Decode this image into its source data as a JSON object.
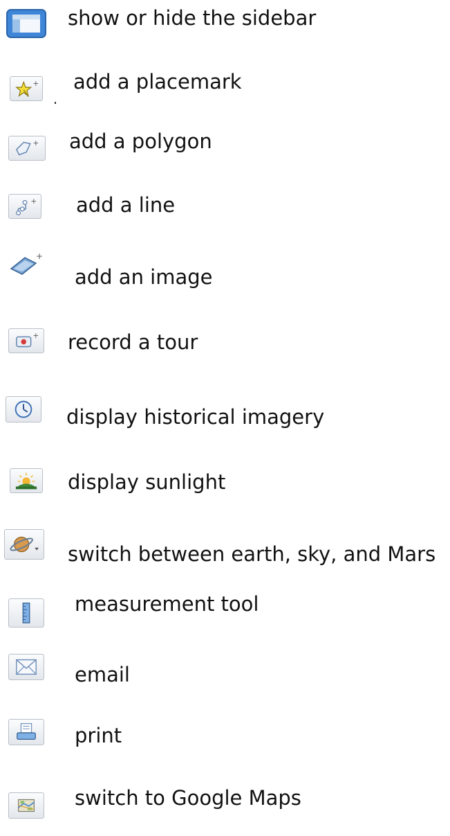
{
  "items": [
    {
      "icon": "sidebar-icon",
      "label": "show or hide the sidebar"
    },
    {
      "icon": "placemark-icon",
      "label": "add a placemark"
    },
    {
      "icon": "polygon-icon",
      "label": "add a polygon"
    },
    {
      "icon": "path-icon",
      "label": "add a line"
    },
    {
      "icon": "image-overlay-icon",
      "label": "add an image"
    },
    {
      "icon": "record-tour-icon",
      "label": "record a tour"
    },
    {
      "icon": "clock-icon",
      "label": "display historical imagery"
    },
    {
      "icon": "sunlight-icon",
      "label": "display sunlight"
    },
    {
      "icon": "planet-icon",
      "label": "switch between earth, sky, and Mars"
    },
    {
      "icon": "ruler-icon",
      "label": "measurement tool"
    },
    {
      "icon": "email-icon",
      "label": "email"
    },
    {
      "icon": "print-icon",
      "label": "print"
    },
    {
      "icon": "map-icon",
      "label": "switch to Google Maps"
    }
  ]
}
